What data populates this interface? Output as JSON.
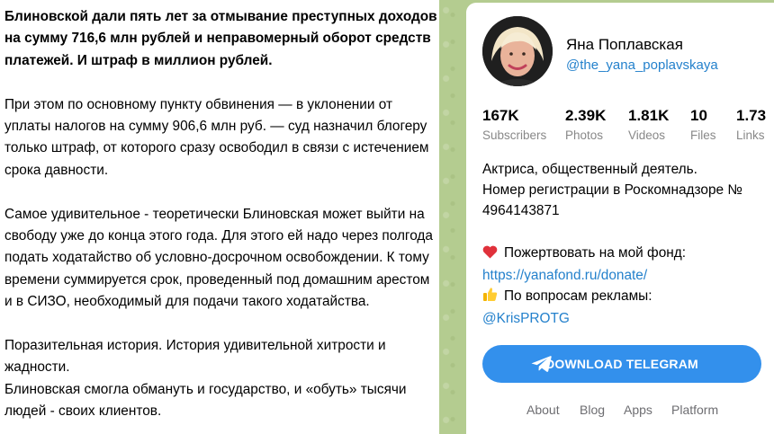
{
  "post": {
    "headline": "Блиновской дали пять лет за отмывание преступных доходов на сумму 716,6 млн рублей и неправомерный оборот средств платежей. И штраф в миллион рублей.",
    "paragraphs": [
      "При этом по основному пункту обвинения — в уклонении от уплаты налогов на сумму 906,6 млн руб. — суд назначил блогеру только штраф, от которого сразу освободил в связи с истечением срока давности.",
      "Самое удивительное - теоретически Блиновская может выйти на свободу уже до конца этого года. Для этого ей надо через полгода подать ходатайство об условно-досрочном освобождении. К тому времени суммируется срок, проведенный под домашним арестом и в СИЗО, необходимый для подачи такого ходатайства.",
      "Поразительная история. История удивительной хитрости и жадности.",
      "Блиновская смогла обмануть и государство, и «обуть» тысячи людей - своих клиентов."
    ]
  },
  "channel": {
    "name": "Яна Поплавская",
    "handle": "@the_yana_poplavskaya",
    "stats": [
      {
        "value": "167K",
        "label": "Subscribers"
      },
      {
        "value": "2.39K",
        "label": "Photos"
      },
      {
        "value": "1.81K",
        "label": "Videos"
      },
      {
        "value": "10",
        "label": "Files"
      },
      {
        "value": "1.73",
        "label": "Links"
      }
    ],
    "description": {
      "line1": "Актриса, общественный деятель.",
      "line2": "Номер регистрации в Роскомнадзоре №",
      "line3": "4964143871",
      "donate_emoji": "❤️",
      "donate_text": "Пожертвовать на мой фонд:",
      "donate_link": "https://yanafond.ru/donate/",
      "ads_emoji": "👍",
      "ads_text": "По вопросам рекламы:",
      "ads_link": "@KrisPROTG"
    },
    "download_label": "DOWNLOAD TELEGRAM",
    "accent_color": "#3390ec",
    "link_color": "#2481cc",
    "background_color": "#b4cc90"
  },
  "footer": {
    "links": [
      "About",
      "Blog",
      "Apps",
      "Platform"
    ]
  }
}
